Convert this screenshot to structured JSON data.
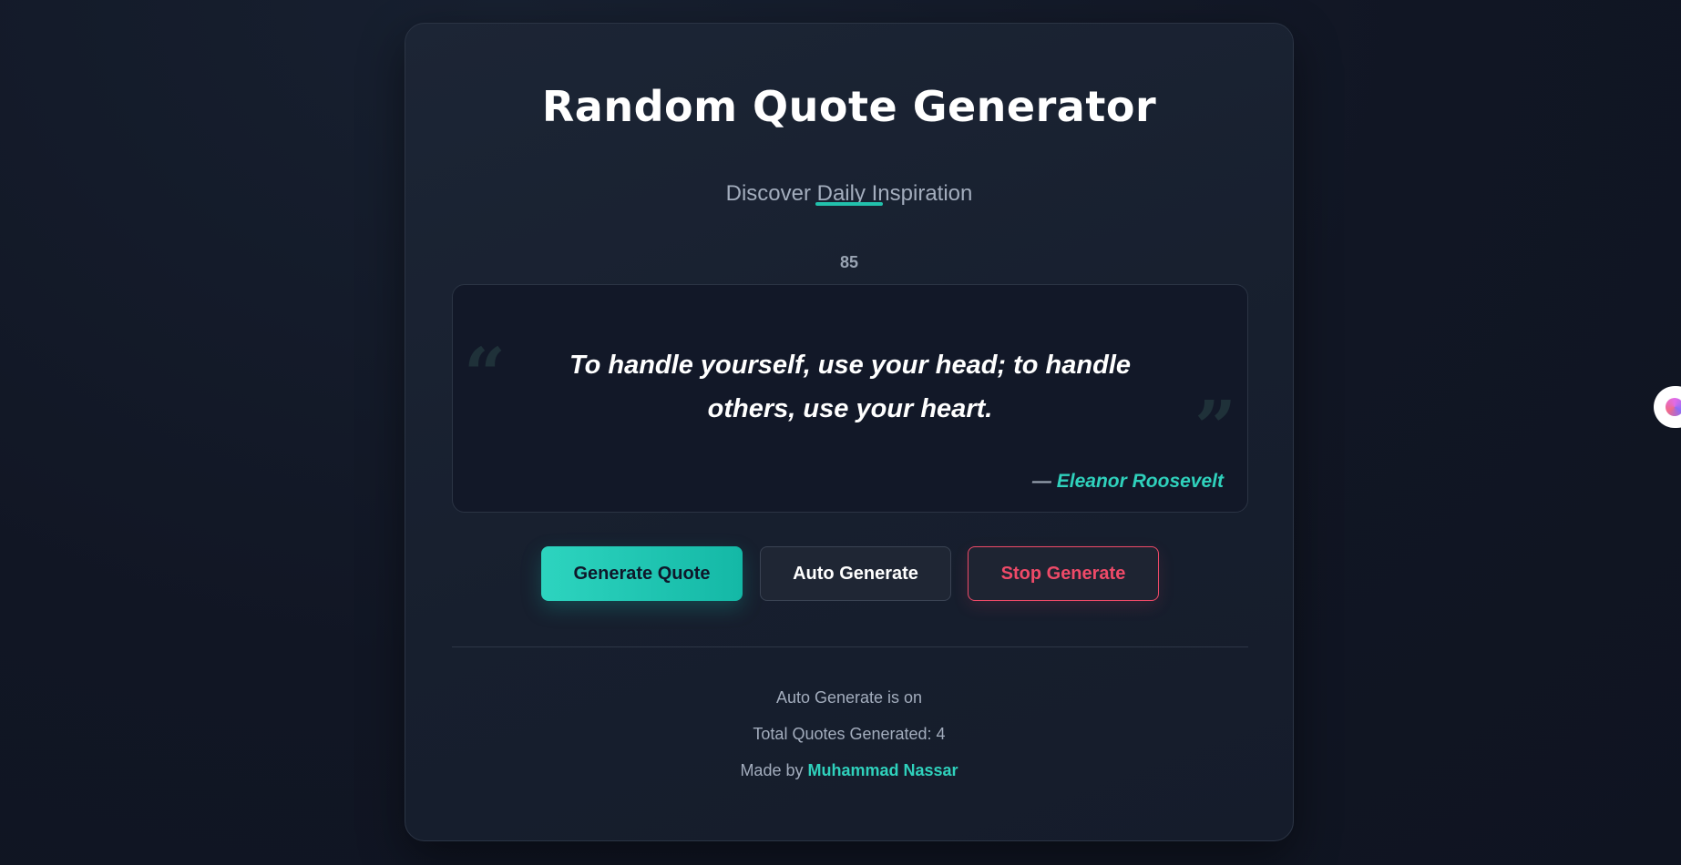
{
  "header": {
    "title": "Random Quote Generator",
    "subtitle": "Discover Daily Inspiration",
    "counter": "85"
  },
  "quote": {
    "open_mark": "“",
    "close_mark": "”",
    "text": "To handle yourself, use your head; to handle others, use your heart.",
    "author_prefix": "— ",
    "author": "Eleanor Roosevelt"
  },
  "buttons": {
    "generate": "Generate Quote",
    "auto": "Auto Generate",
    "stop": "Stop Generate"
  },
  "footer": {
    "status": "Auto Generate is on",
    "total": "Total Quotes Generated: 4",
    "made_by_prefix": "Made by ",
    "made_by_name": "Muhammad Nassar"
  },
  "side_widget": {
    "icon": "brain-icon"
  },
  "colors": {
    "accent": "#2dd4bf",
    "danger": "#ef4a68",
    "background": "#111624",
    "card": "#1a2231"
  }
}
